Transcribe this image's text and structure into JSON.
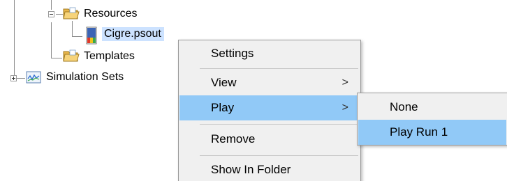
{
  "tree": {
    "resources_label": "Resources",
    "file_label": "Cigre.psout",
    "templates_label": "Templates",
    "simsets_label": "Simulation Sets"
  },
  "context_menu": {
    "settings": "Settings",
    "view": "View",
    "play": "Play",
    "remove": "Remove",
    "show_in_folder": "Show In Folder",
    "submenu_arrow": ">"
  },
  "play_submenu": {
    "none": "None",
    "play_run_1": "Play Run 1"
  },
  "colors": {
    "highlight": "#91c9f7",
    "selection": "#cce2ff",
    "menu_bg": "#f0f0f0"
  }
}
